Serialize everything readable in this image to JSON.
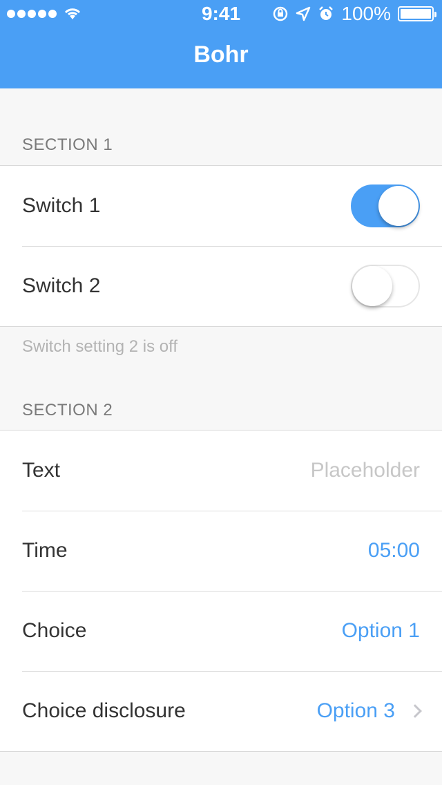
{
  "status_bar": {
    "time": "9:41",
    "battery": "100%",
    "icons": [
      "signal-dots-icon",
      "wifi-icon",
      "rotation-lock-icon",
      "location-arrow-icon",
      "alarm-icon",
      "battery-icon"
    ]
  },
  "nav": {
    "title": "Bohr"
  },
  "section1": {
    "header": "SECTION 1",
    "rows": [
      {
        "label": "Switch 1",
        "switch_on": true
      },
      {
        "label": "Switch 2",
        "switch_on": false
      }
    ],
    "footer": "Switch setting 2 is off"
  },
  "section2": {
    "header": "SECTION 2",
    "text_row": {
      "label": "Text",
      "placeholder": "Placeholder"
    },
    "time_row": {
      "label": "Time",
      "value": "05:00"
    },
    "choice_row": {
      "label": "Choice",
      "value": "Option 1"
    },
    "disclosure_row": {
      "label": "Choice disclosure",
      "value": "Option 3"
    }
  },
  "colors": {
    "accent": "#4a9ff5",
    "background": "#f7f7f7"
  }
}
